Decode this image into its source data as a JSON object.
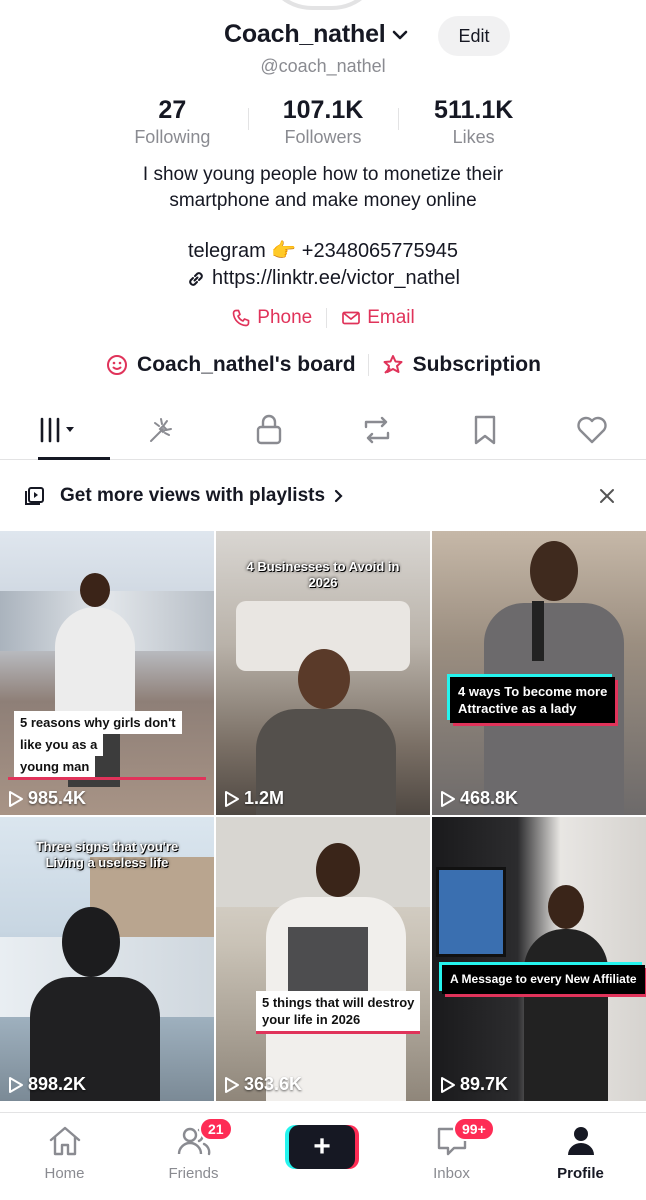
{
  "profile": {
    "username": "Coach_nathel",
    "handle": "@coach_nathel",
    "edit_label": "Edit",
    "stats": [
      {
        "value": "27",
        "label": "Following"
      },
      {
        "value": "107.1K",
        "label": "Followers"
      },
      {
        "value": "511.1K",
        "label": "Likes"
      }
    ],
    "bio_line1": "I show young people how to monetize their",
    "bio_line2": "smartphone and make money online",
    "telegram": "telegram 👉 +2348065775945",
    "link": "https://linktr.ee/victor_nathel",
    "phone_label": "Phone",
    "email_label": "Email",
    "board_label": "Coach_nathel's board",
    "subscription_label": "Subscription"
  },
  "tabs": [
    {
      "icon": "videos-grid-icon"
    },
    {
      "icon": "spark-icon"
    },
    {
      "icon": "lock-icon"
    },
    {
      "icon": "repost-icon"
    },
    {
      "icon": "bookmark-icon"
    },
    {
      "icon": "heart-icon"
    }
  ],
  "playlist_banner": {
    "text": "Get more views with playlists"
  },
  "videos": [
    {
      "views": "985.4K",
      "caption": "5 reasons why girls don't like you as a young man"
    },
    {
      "views": "1.2M",
      "caption": "4 Businesses to Avoid in 2026"
    },
    {
      "views": "468.8K",
      "caption": "4 ways To become more Attractive as a lady"
    },
    {
      "views": "898.2K",
      "caption": "Three signs that you're Living a useless life"
    },
    {
      "views": "363.6K",
      "caption": "5 things that will destroy your life in 2026"
    },
    {
      "views": "89.7K",
      "caption": "A Message to every New Affiliate"
    }
  ],
  "caption_lines": {
    "v1": [
      "5 reasons why girls don't",
      "like you as a",
      "young man"
    ],
    "v2": [
      "4 Businesses to Avoid in",
      "2026"
    ],
    "v3": [
      "4 ways To become more",
      "Attractive as a lady"
    ],
    "v4": [
      "Three signs that you're",
      "Living a useless life"
    ],
    "v5": [
      "5 things that will destroy",
      "your life in 2026"
    ],
    "v6": [
      "A Message to every New Affiliate"
    ]
  },
  "nav": {
    "home": "Home",
    "friends": "Friends",
    "friends_badge": "21",
    "inbox": "Inbox",
    "inbox_badge": "99+",
    "profile": "Profile",
    "create_symbol": "+"
  },
  "colors": {
    "accent": "#fe2c55",
    "link_red": "#e0335a",
    "text": "#161823",
    "muted": "#8a8b91"
  }
}
